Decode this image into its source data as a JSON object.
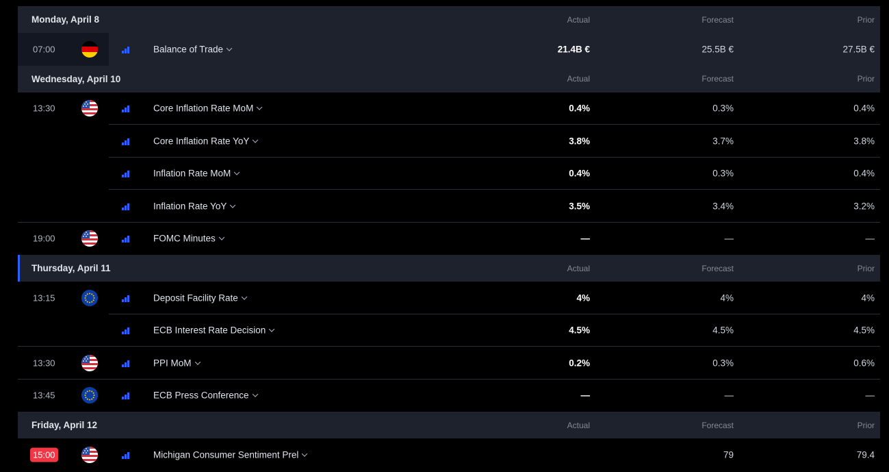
{
  "columns": {
    "actual": "Actual",
    "forecast": "Forecast",
    "prior": "Prior"
  },
  "days": [
    {
      "title": "Monday, April 8",
      "events": [
        {
          "time": "07:00",
          "flag": "germany-flag-icon",
          "name": "Balance of Trade",
          "actual": "21.4B €",
          "forecast": "25.5B €",
          "prior": "27.5B €"
        }
      ]
    },
    {
      "title": "Wednesday, April 10",
      "events": [
        {
          "time": "13:30",
          "flag": "usa-flag-icon",
          "name": "Core Inflation Rate MoM",
          "actual": "0.4%",
          "forecast": "0.3%",
          "prior": "0.4%"
        },
        {
          "time": "",
          "flag": "",
          "name": "Core Inflation Rate YoY",
          "actual": "3.8%",
          "forecast": "3.7%",
          "prior": "3.8%"
        },
        {
          "time": "",
          "flag": "",
          "name": "Inflation Rate MoM",
          "actual": "0.4%",
          "forecast": "0.3%",
          "prior": "0.4%"
        },
        {
          "time": "",
          "flag": "",
          "name": "Inflation Rate YoY",
          "actual": "3.5%",
          "forecast": "3.4%",
          "prior": "3.2%"
        },
        {
          "time": "19:00",
          "flag": "usa-flag-icon",
          "name": "FOMC Minutes",
          "actual": "—",
          "forecast": "—",
          "prior": "—"
        }
      ]
    },
    {
      "title": "Thursday, April 11",
      "events": [
        {
          "time": "13:15",
          "flag": "eu-flag-icon",
          "name": "Deposit Facility Rate",
          "actual": "4%",
          "forecast": "4%",
          "prior": "4%"
        },
        {
          "time": "",
          "flag": "",
          "name": "ECB Interest Rate Decision",
          "actual": "4.5%",
          "forecast": "4.5%",
          "prior": "4.5%"
        },
        {
          "time": "13:30",
          "flag": "usa-flag-icon",
          "name": "PPI MoM",
          "actual": "0.2%",
          "forecast": "0.3%",
          "prior": "0.6%"
        },
        {
          "time": "13:45",
          "flag": "eu-flag-icon",
          "name": "ECB Press Conference",
          "actual": "—",
          "forecast": "—",
          "prior": "—"
        }
      ]
    },
    {
      "title": "Friday, April 12",
      "events": [
        {
          "time": "15:00",
          "flag": "usa-flag-icon",
          "name": "Michigan Consumer Sentiment Prel",
          "actual": "",
          "forecast": "79",
          "prior": "79.4"
        }
      ]
    }
  ],
  "colors": {
    "accent": "#2962ff",
    "live": "#f23645",
    "header_bg": "#1e222d",
    "row_bg": "#000000"
  }
}
